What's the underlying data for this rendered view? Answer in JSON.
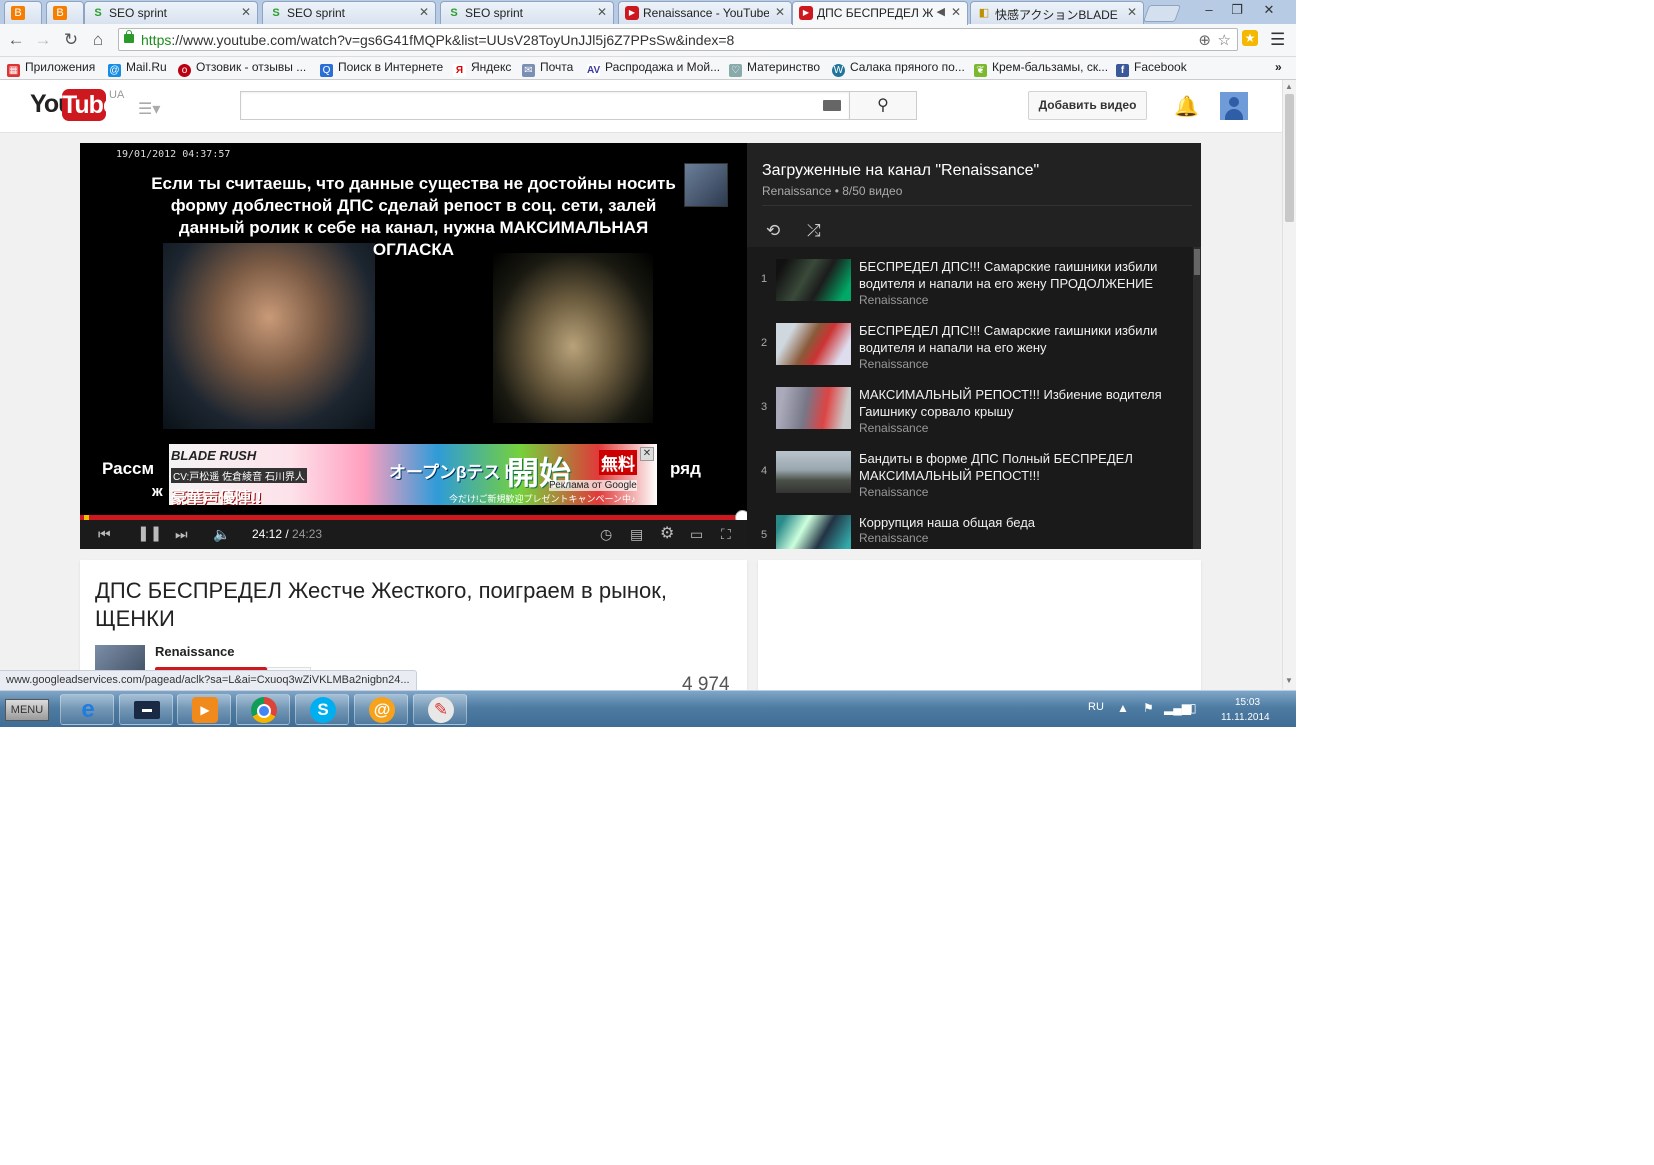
{
  "browser": {
    "tabs": [
      {
        "label": "",
        "icon": "blogger-icon"
      },
      {
        "label": "SEO sprint",
        "icon": "seosprint-icon"
      },
      {
        "label": "SEO sprint",
        "icon": "seosprint-icon"
      },
      {
        "label": "SEO sprint",
        "icon": "seosprint-icon"
      },
      {
        "label": "Renaissance - YouTube",
        "icon": "youtube-icon"
      },
      {
        "label": "ДПС БЕСПРЕДЕЛ Ж",
        "icon": "youtube-icon",
        "active": true
      },
      {
        "label": "快感アクションBLADE RU",
        "icon": "page-icon"
      }
    ],
    "url_scheme": "https",
    "url_rest": "://www.youtube.com/watch?v=gs6G41fMQPk&list=UUsV28ToyUnJJl5j6Z7PPsSw&index=8",
    "bookmarks": [
      {
        "label": "Приложения",
        "icon": "apps-icon"
      },
      {
        "label": "Mail.Ru",
        "icon": "mailru-icon"
      },
      {
        "label": "Отзовик - отзывы ...",
        "icon": "otzovik-icon"
      },
      {
        "label": "Поиск в Интернете",
        "icon": "search-icon"
      },
      {
        "label": "Яндекс",
        "icon": "yandex-icon"
      },
      {
        "label": "Почта",
        "icon": "mail-icon"
      },
      {
        "label": "Распродажа и Мой...",
        "icon": "sale-icon"
      },
      {
        "label": "Материнство",
        "icon": "maternity-icon"
      },
      {
        "label": "Салака пряного по...",
        "icon": "wordpress-icon"
      },
      {
        "label": "Крем-бальзамы, ск...",
        "icon": "leaf-icon"
      },
      {
        "label": "Facebook",
        "icon": "facebook-icon"
      }
    ],
    "bookmarks_overflow": "»",
    "status_url": "www.googleadservices.com/pagead/aclk?sa=L&ai=Cxuoq3wZiVKLMBa2nigbn24..."
  },
  "youtube": {
    "logo_you": "You",
    "logo_tube": "Tube",
    "region": "UA",
    "search_value": "",
    "upload_label": "Добавить видео",
    "player": {
      "timestamp_overlay": "19/01/2012 04:37:57",
      "caption_lines": [
        "Если ты считаешь, что данные существа не достойны носить",
        "форму доблестной ДПС сделай репост в соц. сети, залей",
        "данный ролик к себе на канал, нужна МАКСИМАЛЬНАЯ",
        "ОГЛАСКА"
      ],
      "caption_bottom_left": "Рассм",
      "caption_bottom_right": "ряд",
      "caption_bottom_2": "ж",
      "ad": {
        "brand": "BLADE RUSH",
        "cast": "CV:戸松遥 佐倉綾音 石川界人",
        "tagline": "豪華声優陣!!",
        "open_beta": "オープンβテスト",
        "start": "開始",
        "free": "無料",
        "label": "Реклама от Google",
        "campaign": "今だけ!ご新規歓迎プレゼントキャンペーン中♪"
      },
      "current_time": "24:12",
      "duration": "24:23",
      "progress": 0.992
    },
    "playlist": {
      "title": "Загруженные на канал \"Renaissance\"",
      "subtitle": "Renaissance • 8/50 видео",
      "items": [
        {
          "index": "1",
          "title": "БЕСПРЕДЕЛ ДПС!!! Самарские гаишники избили водителя и напали на его жену ПРОДОЛЖЕНИЕ",
          "channel": "Renaissance"
        },
        {
          "index": "2",
          "title": "БЕСПРЕДЕЛ ДПС!!! Самарские гаишники избили водителя и напали на его жену",
          "channel": "Renaissance"
        },
        {
          "index": "3",
          "title": "МАКСИМАЛЬНЫЙ РЕПОСТ!!! Избиение водителя Гаишнику сорвало крышу",
          "channel": "Renaissance"
        },
        {
          "index": "4",
          "title": "Бандиты в форме ДПС Полный БЕСПРЕДЕЛ МАКСИМАЛЬНЫЙ РЕПОСТ!!!",
          "channel": "Renaissance"
        },
        {
          "index": "5",
          "title": "Коррупция наша общая беда",
          "channel": "Renaissance"
        }
      ]
    },
    "video": {
      "title": "ДПС БЕСПРЕДЕЛ Жестче Жесткого, поиграем в рынок, ЩЕНКИ",
      "owner": "Renaissance",
      "views": "4 974"
    }
  },
  "taskbar": {
    "menu_label": "MENU",
    "apps": [
      "internet-explorer-icon",
      "desktop-icon",
      "media-player-icon",
      "chrome-icon",
      "skype-icon",
      "icq-icon",
      "paint-icon"
    ],
    "language": "RU",
    "time": "15:03",
    "date": "11.11.2014"
  },
  "colors": {
    "youtube_red": "#cc181e",
    "player_bg": "#000000",
    "playlist_bg": "#222222",
    "page_bg": "#f1f1f1",
    "secure_green": "#1e8c1e"
  }
}
